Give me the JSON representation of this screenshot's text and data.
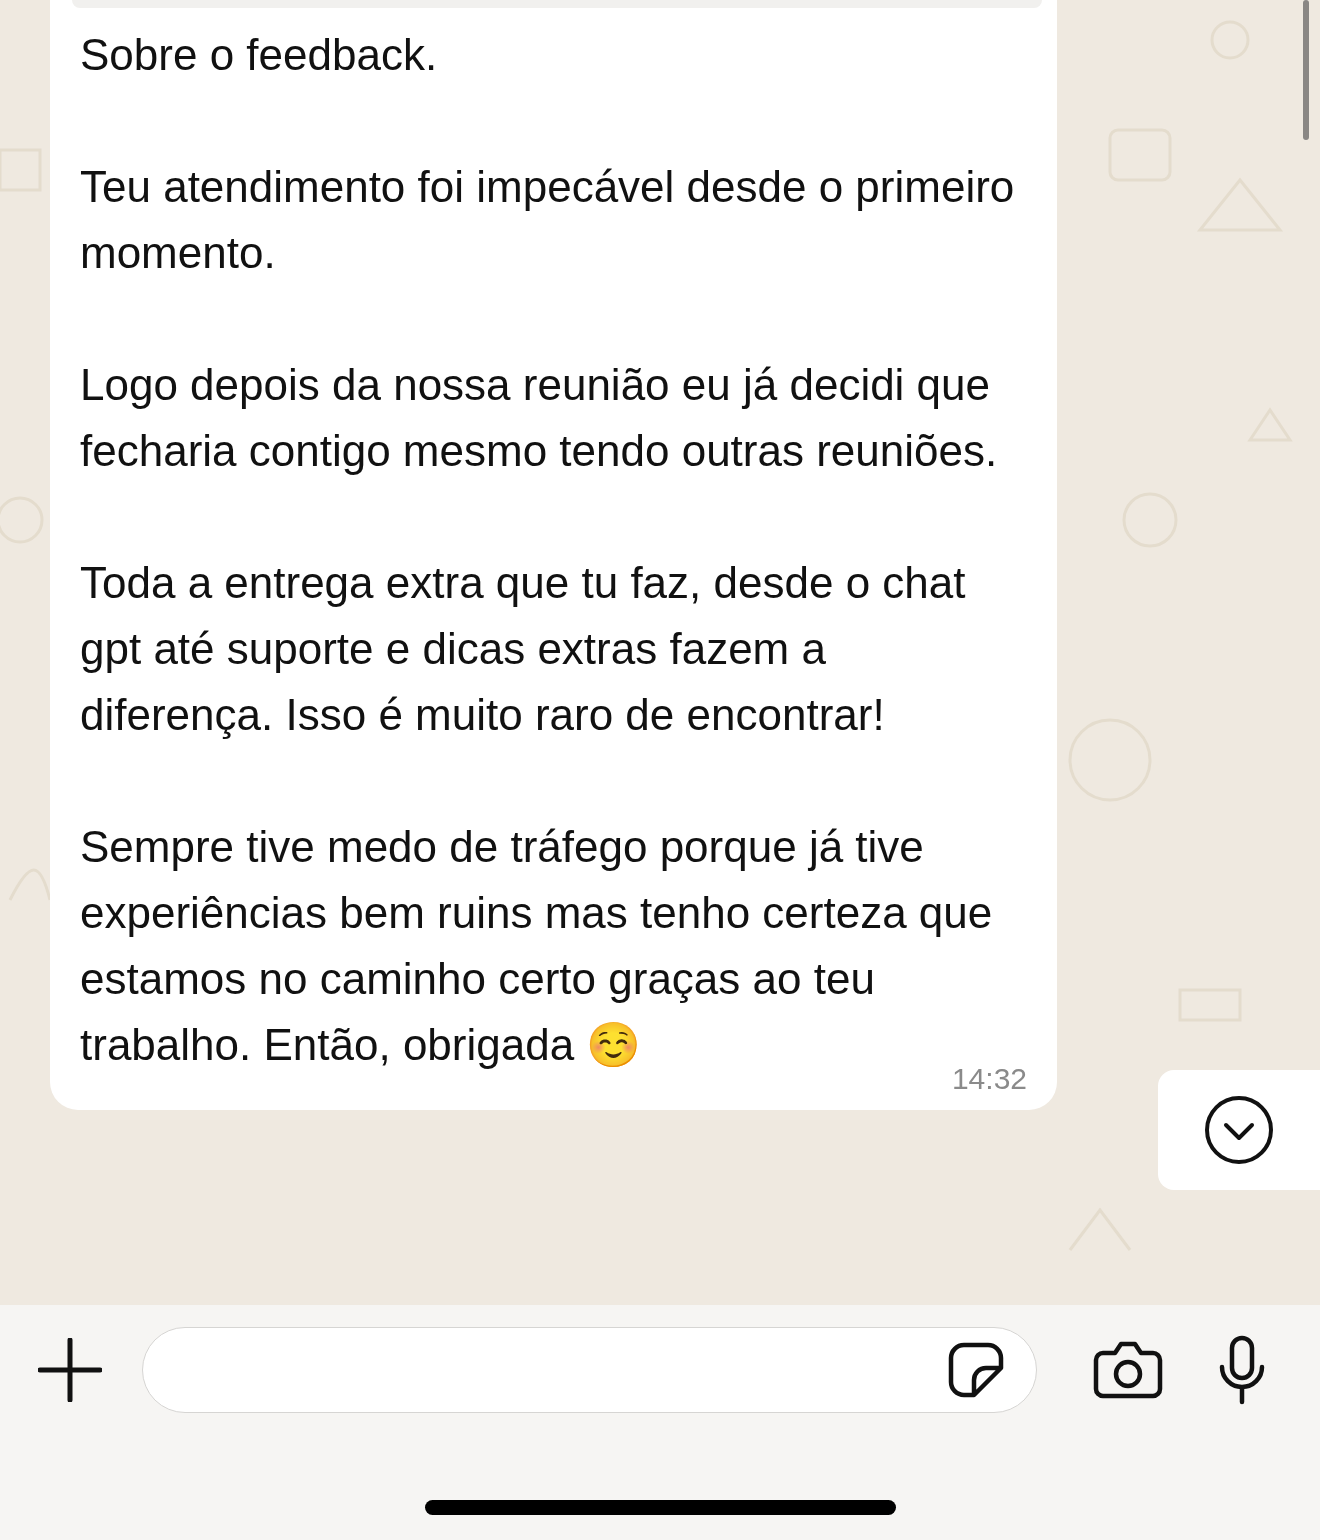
{
  "message": {
    "paragraphs": [
      "Sobre o feedback.",
      "Teu atendimento foi impecável desde o primeiro momento.",
      "Logo depois da nossa reunião eu já decidi que fecharia contigo mesmo tendo outras reuniões.",
      "Toda a entrega extra que tu faz, desde o chat gpt até suporte e dicas extras fazem a diferença. Isso é muito raro de encontrar!",
      "Sempre tive medo de tráfego porque já tive experiências bem ruins mas tenho certeza que estamos no caminho certo graças ao teu trabalho. Então, obrigada ☺️"
    ],
    "time": "14:32"
  }
}
